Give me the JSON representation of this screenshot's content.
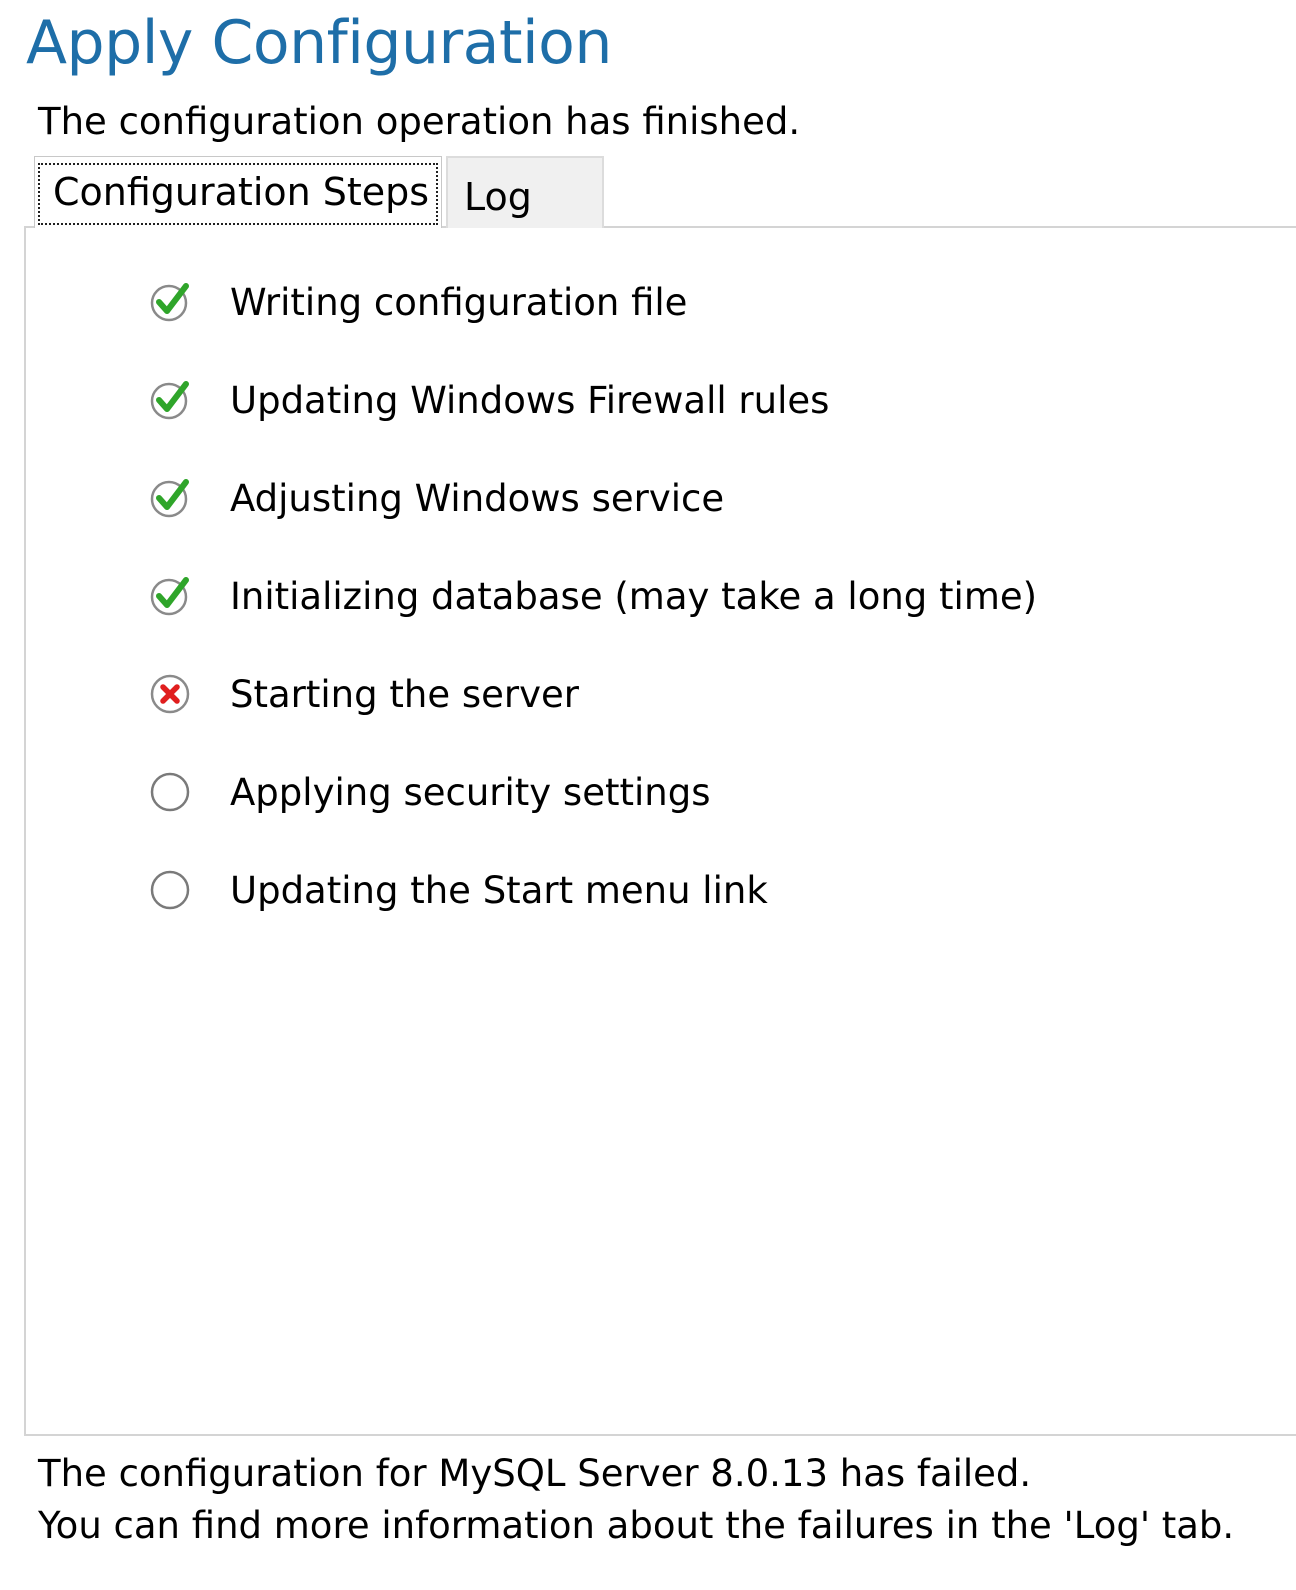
{
  "header": {
    "title": "Apply Configuration",
    "status": "The configuration operation has finished."
  },
  "tabs": [
    {
      "label": "Configuration Steps",
      "active": true
    },
    {
      "label": "Log",
      "active": false
    }
  ],
  "steps": [
    {
      "label": "Writing configuration file",
      "status": "success",
      "icon": "check-circle-icon"
    },
    {
      "label": "Updating Windows Firewall rules",
      "status": "success",
      "icon": "check-circle-icon"
    },
    {
      "label": "Adjusting Windows service",
      "status": "success",
      "icon": "check-circle-icon"
    },
    {
      "label": "Initializing database (may take a long time)",
      "status": "success",
      "icon": "check-circle-icon"
    },
    {
      "label": "Starting the server",
      "status": "failed",
      "icon": "error-x-icon"
    },
    {
      "label": "Applying security settings",
      "status": "pending",
      "icon": "empty-circle-icon"
    },
    {
      "label": "Updating the Start menu link",
      "status": "pending",
      "icon": "empty-circle-icon"
    }
  ],
  "footer": {
    "line1": "The configuration for MySQL Server 8.0.13 has failed.",
    "line2": "You can find more information about the failures in the 'Log' tab."
  },
  "colors": {
    "title": "#1e6ea8",
    "success": "#2fa52a",
    "failed": "#e01e1e"
  }
}
